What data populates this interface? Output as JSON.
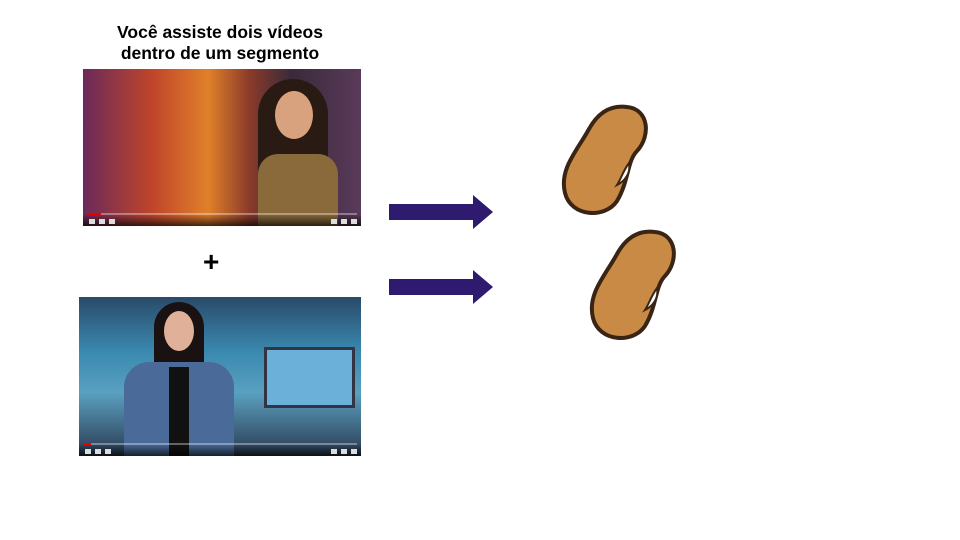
{
  "title": "Você assiste dois vídeos dentro de um segmento",
  "plus_symbol": "+",
  "videos": [
    {
      "name": "video-1",
      "progress": 0.05
    },
    {
      "name": "video-2",
      "progress": 0.03
    }
  ],
  "colors": {
    "arrow": "#2e1a6e",
    "bean": "#c98a45",
    "bean_outline": "#3a2414"
  },
  "icons": [
    "play-icon",
    "next-icon",
    "volume-icon",
    "settings-icon",
    "theater-icon",
    "fullscreen-icon",
    "arrow-right-icon",
    "bean-icon"
  ]
}
